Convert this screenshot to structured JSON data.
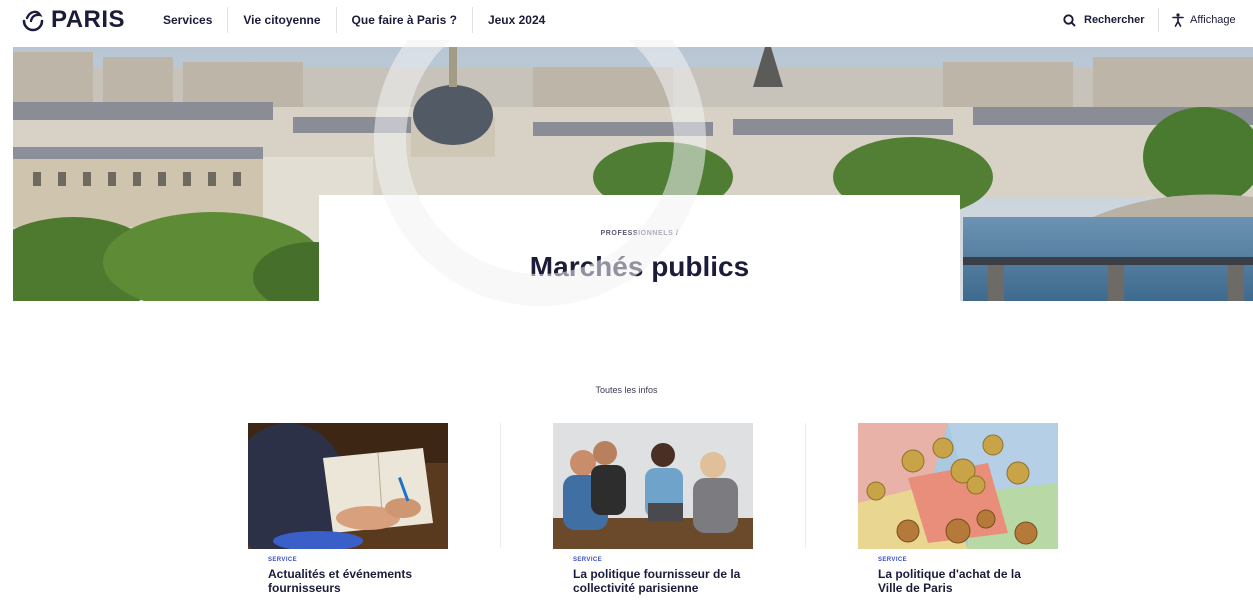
{
  "brand": {
    "logo_text": "PARIS"
  },
  "nav": {
    "items": [
      "Services",
      "Vie citoyenne",
      "Que faire à Paris ?",
      "Jeux 2024"
    ]
  },
  "header_tools": {
    "search_label": "Rechercher",
    "display_label": "Affichage"
  },
  "hero": {
    "breadcrumb": "PROFESSIONNELS  /",
    "title": "Marchés publics"
  },
  "section": {
    "label": "Toutes les infos"
  },
  "cards": [
    {
      "tag": "SERVICE",
      "title": "Actualités et événements fournisseurs"
    },
    {
      "tag": "SERVICE",
      "title": "La politique fournisseur de la collectivité parisienne"
    },
    {
      "tag": "SERVICE",
      "title": "La politique d'achat de la Ville de Paris"
    }
  ],
  "colors": {
    "primary": "#1b1c3a",
    "tag": "#3a4fc7"
  }
}
